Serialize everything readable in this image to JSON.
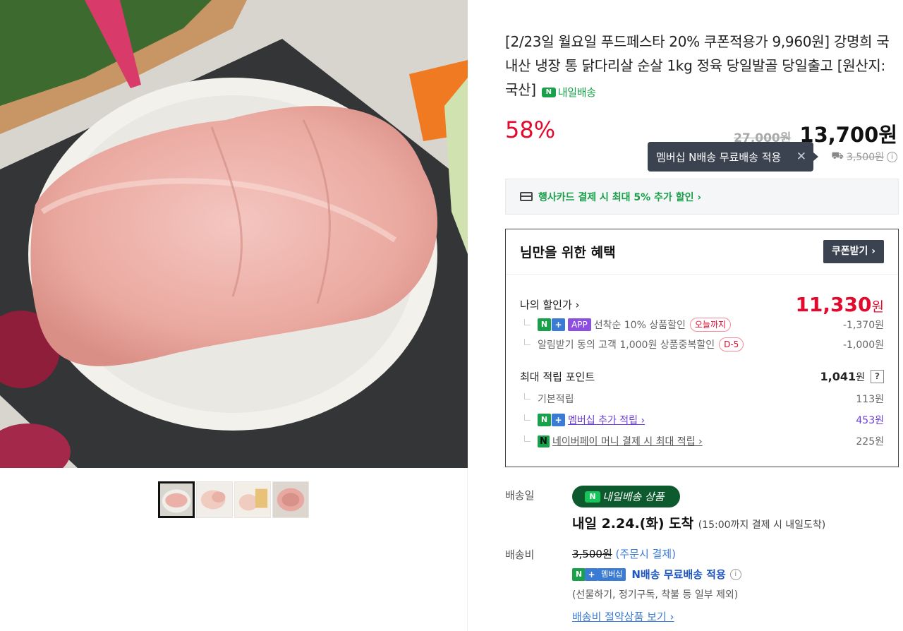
{
  "product": {
    "title": "[2/23일 월요일 푸드페스타 20% 쿠폰적용가 9,960원] 강명희 국내산 냉장 통 닭다리살 순살 1kg 정육 당일발골 당일출고 [원산지:국산]",
    "tomorrow_badge": "내일배송",
    "discount": "58%",
    "original_price": "27,000원",
    "sale_price": "13,700원"
  },
  "tooltip": {
    "text": "멤버십 N배송 무료배송 적용",
    "close": "✕"
  },
  "shipping_small": {
    "price": "3,500원",
    "info_icon": "i"
  },
  "card_banner": {
    "text": "행사카드 결제 시 최대 5% 추가 할인 ›"
  },
  "benefit": {
    "title": "님만을 위한 혜택",
    "coupon_button": "쿠폰받기 ›",
    "my_price_label": "나의 할인가 ›",
    "my_price_value": "11,330",
    "my_price_unit": "원",
    "discounts": [
      {
        "n": "N",
        "plus": "+",
        "app": "APP",
        "label": "선착순 10% 상품할인",
        "tag": "오늘까지",
        "value": "-1,370원"
      },
      {
        "label": "알림받기 동의 고객 1,000원 상품중복할인",
        "tag": "D-5",
        "value": "-1,000원"
      }
    ],
    "points_label": "최대 적립 포인트",
    "points_value": "1,041",
    "points_unit": "원",
    "points_help": "?",
    "points": [
      {
        "label": "기본적립",
        "value": "113원"
      },
      {
        "n": "N",
        "plus": "+",
        "label": "멤버십 추가 적립 ›",
        "value": "453원"
      },
      {
        "npay": "N",
        "label": "네이버페이 머니 결제 시 최대 적립 ›",
        "value": "225원"
      }
    ]
  },
  "delivery": {
    "date_label": "배송일",
    "pill": "내일배송 상품",
    "pill_n": "N",
    "arrive": "내일 2.24.(화) 도착",
    "arrive_note": "(15:00까지 결제 시 내일도착)",
    "fee_label": "배송비",
    "fee": "3,500원",
    "fee_note": "(주문시 결제)",
    "member_n": "N",
    "member_plus": "+",
    "member_badge": "멤버십",
    "member_text": "N배송 무료배송 적용",
    "member_info": "i",
    "exclude": "(선물하기, 정기구독, 착불 등 일부 제외)",
    "save_link": "배송비 절약상품 보기 ›"
  },
  "colors": {
    "accent_red": "#e30a2e",
    "naver_green": "#19a04a",
    "dark_button": "#3b4350",
    "member_blue": "#3a7bd5",
    "purple": "#6c3fd8"
  }
}
